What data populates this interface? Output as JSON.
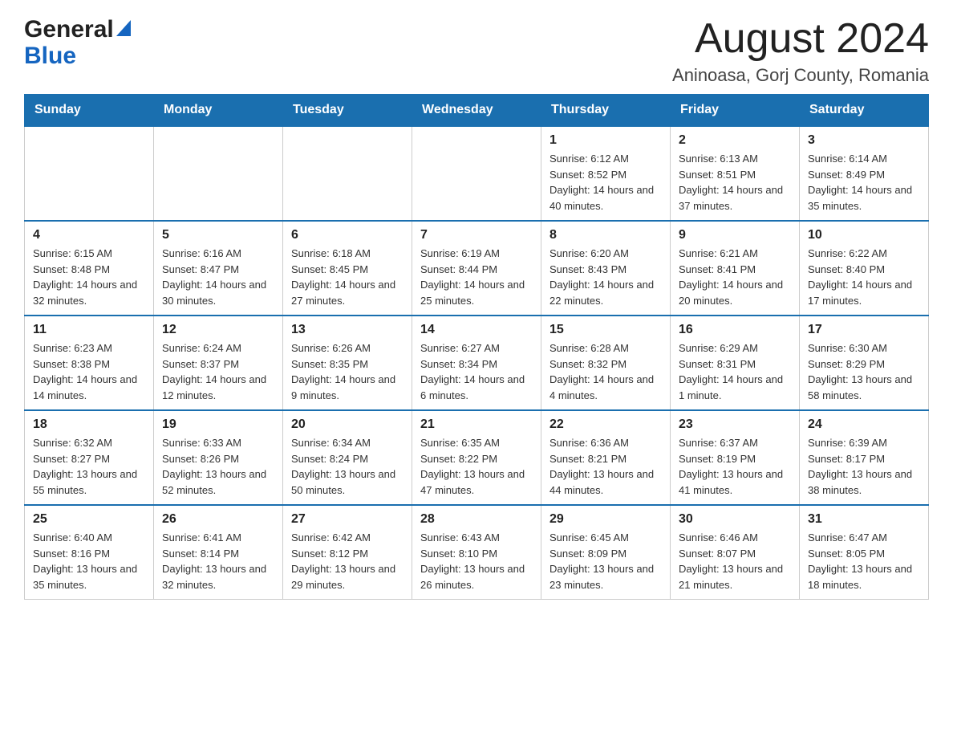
{
  "header": {
    "logo_general": "General",
    "logo_blue": "Blue",
    "title": "August 2024",
    "subtitle": "Aninoasa, Gorj County, Romania"
  },
  "days_of_week": [
    "Sunday",
    "Monday",
    "Tuesday",
    "Wednesday",
    "Thursday",
    "Friday",
    "Saturday"
  ],
  "weeks": [
    [
      {
        "day": "",
        "info": ""
      },
      {
        "day": "",
        "info": ""
      },
      {
        "day": "",
        "info": ""
      },
      {
        "day": "",
        "info": ""
      },
      {
        "day": "1",
        "info": "Sunrise: 6:12 AM\nSunset: 8:52 PM\nDaylight: 14 hours and 40 minutes."
      },
      {
        "day": "2",
        "info": "Sunrise: 6:13 AM\nSunset: 8:51 PM\nDaylight: 14 hours and 37 minutes."
      },
      {
        "day": "3",
        "info": "Sunrise: 6:14 AM\nSunset: 8:49 PM\nDaylight: 14 hours and 35 minutes."
      }
    ],
    [
      {
        "day": "4",
        "info": "Sunrise: 6:15 AM\nSunset: 8:48 PM\nDaylight: 14 hours and 32 minutes."
      },
      {
        "day": "5",
        "info": "Sunrise: 6:16 AM\nSunset: 8:47 PM\nDaylight: 14 hours and 30 minutes."
      },
      {
        "day": "6",
        "info": "Sunrise: 6:18 AM\nSunset: 8:45 PM\nDaylight: 14 hours and 27 minutes."
      },
      {
        "day": "7",
        "info": "Sunrise: 6:19 AM\nSunset: 8:44 PM\nDaylight: 14 hours and 25 minutes."
      },
      {
        "day": "8",
        "info": "Sunrise: 6:20 AM\nSunset: 8:43 PM\nDaylight: 14 hours and 22 minutes."
      },
      {
        "day": "9",
        "info": "Sunrise: 6:21 AM\nSunset: 8:41 PM\nDaylight: 14 hours and 20 minutes."
      },
      {
        "day": "10",
        "info": "Sunrise: 6:22 AM\nSunset: 8:40 PM\nDaylight: 14 hours and 17 minutes."
      }
    ],
    [
      {
        "day": "11",
        "info": "Sunrise: 6:23 AM\nSunset: 8:38 PM\nDaylight: 14 hours and 14 minutes."
      },
      {
        "day": "12",
        "info": "Sunrise: 6:24 AM\nSunset: 8:37 PM\nDaylight: 14 hours and 12 minutes."
      },
      {
        "day": "13",
        "info": "Sunrise: 6:26 AM\nSunset: 8:35 PM\nDaylight: 14 hours and 9 minutes."
      },
      {
        "day": "14",
        "info": "Sunrise: 6:27 AM\nSunset: 8:34 PM\nDaylight: 14 hours and 6 minutes."
      },
      {
        "day": "15",
        "info": "Sunrise: 6:28 AM\nSunset: 8:32 PM\nDaylight: 14 hours and 4 minutes."
      },
      {
        "day": "16",
        "info": "Sunrise: 6:29 AM\nSunset: 8:31 PM\nDaylight: 14 hours and 1 minute."
      },
      {
        "day": "17",
        "info": "Sunrise: 6:30 AM\nSunset: 8:29 PM\nDaylight: 13 hours and 58 minutes."
      }
    ],
    [
      {
        "day": "18",
        "info": "Sunrise: 6:32 AM\nSunset: 8:27 PM\nDaylight: 13 hours and 55 minutes."
      },
      {
        "day": "19",
        "info": "Sunrise: 6:33 AM\nSunset: 8:26 PM\nDaylight: 13 hours and 52 minutes."
      },
      {
        "day": "20",
        "info": "Sunrise: 6:34 AM\nSunset: 8:24 PM\nDaylight: 13 hours and 50 minutes."
      },
      {
        "day": "21",
        "info": "Sunrise: 6:35 AM\nSunset: 8:22 PM\nDaylight: 13 hours and 47 minutes."
      },
      {
        "day": "22",
        "info": "Sunrise: 6:36 AM\nSunset: 8:21 PM\nDaylight: 13 hours and 44 minutes."
      },
      {
        "day": "23",
        "info": "Sunrise: 6:37 AM\nSunset: 8:19 PM\nDaylight: 13 hours and 41 minutes."
      },
      {
        "day": "24",
        "info": "Sunrise: 6:39 AM\nSunset: 8:17 PM\nDaylight: 13 hours and 38 minutes."
      }
    ],
    [
      {
        "day": "25",
        "info": "Sunrise: 6:40 AM\nSunset: 8:16 PM\nDaylight: 13 hours and 35 minutes."
      },
      {
        "day": "26",
        "info": "Sunrise: 6:41 AM\nSunset: 8:14 PM\nDaylight: 13 hours and 32 minutes."
      },
      {
        "day": "27",
        "info": "Sunrise: 6:42 AM\nSunset: 8:12 PM\nDaylight: 13 hours and 29 minutes."
      },
      {
        "day": "28",
        "info": "Sunrise: 6:43 AM\nSunset: 8:10 PM\nDaylight: 13 hours and 26 minutes."
      },
      {
        "day": "29",
        "info": "Sunrise: 6:45 AM\nSunset: 8:09 PM\nDaylight: 13 hours and 23 minutes."
      },
      {
        "day": "30",
        "info": "Sunrise: 6:46 AM\nSunset: 8:07 PM\nDaylight: 13 hours and 21 minutes."
      },
      {
        "day": "31",
        "info": "Sunrise: 6:47 AM\nSunset: 8:05 PM\nDaylight: 13 hours and 18 minutes."
      }
    ]
  ]
}
